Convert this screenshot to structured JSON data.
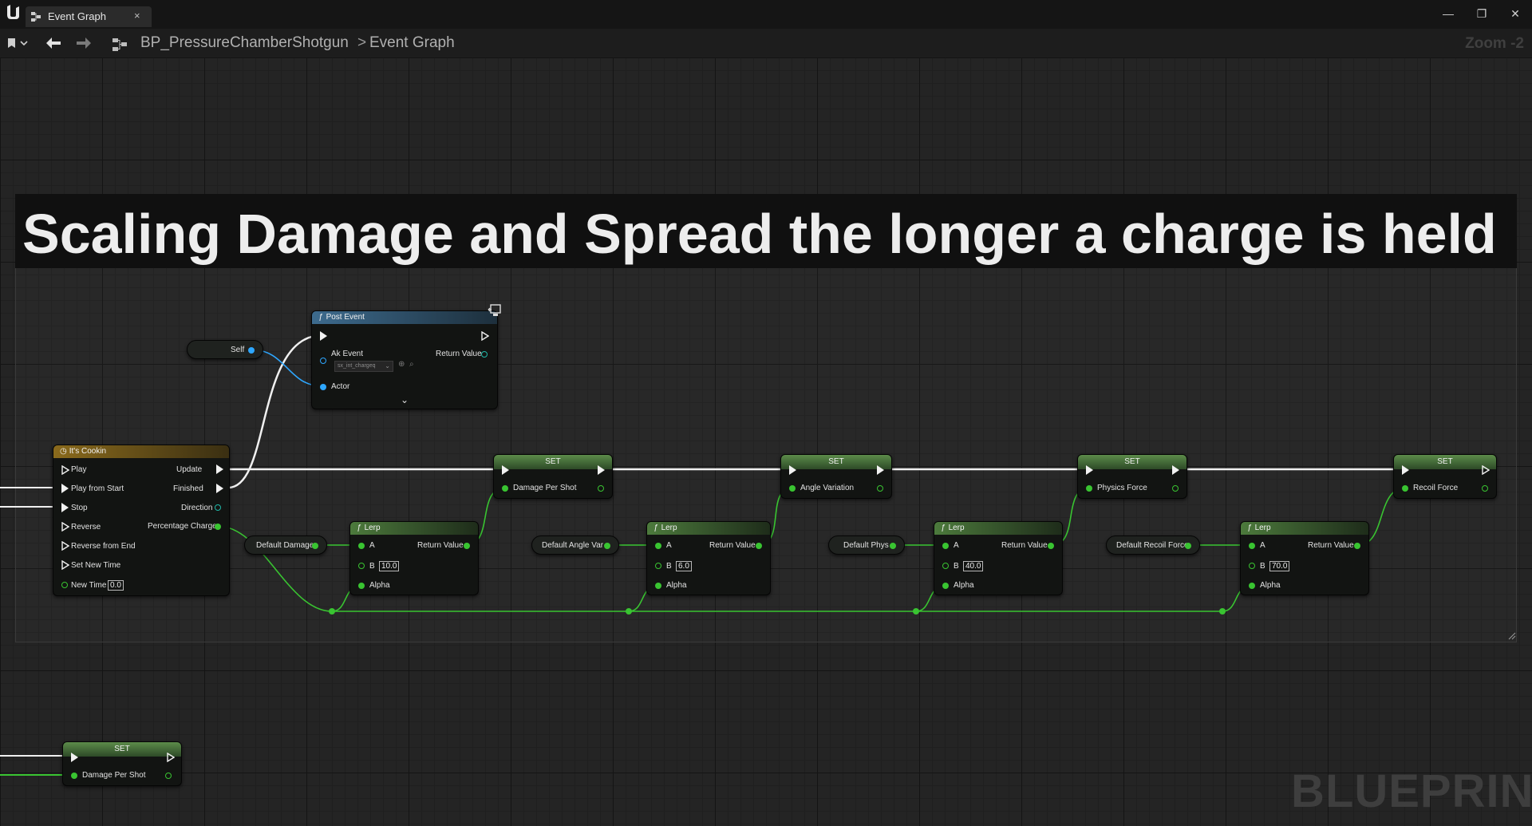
{
  "titlebar": {
    "tab_label": "Event Graph",
    "close_glyph": "×",
    "minimize_glyph": "—",
    "maximize_glyph": "❐",
    "window_close_glyph": "✕"
  },
  "toolbar": {
    "blueprint_name": "BP_PressureChamberShotgun",
    "separator": ">",
    "graph_name": "Event Graph",
    "zoom": "Zoom -2"
  },
  "comment": {
    "title": "Scaling Damage and Spread the longer a charge is held"
  },
  "watermark": "BLUEPRINT",
  "post_event": {
    "title": "Post Event",
    "ak_event_label": "Ak Event",
    "ak_event_value": "sx_int_chargeq",
    "return_value_label": "Return Value",
    "actor_label": "Actor",
    "self_label": "Self"
  },
  "timeline": {
    "title": "It's Cookin",
    "inputs": [
      "Play",
      "Play from Start",
      "Stop",
      "Reverse",
      "Reverse from End",
      "Set New Time"
    ],
    "new_time_label": "New Time",
    "new_time_value": "0.0",
    "outputs": {
      "update": "Update",
      "finished": "Finished",
      "direction": "Direction",
      "percentage": "Percentage Charge"
    }
  },
  "chains": [
    {
      "set_title": "SET",
      "set_var": "Damage Per Shot",
      "default_var": "Default Damage",
      "lerp_title": "Lerp",
      "a": "A",
      "b": "B",
      "b_value": "10.0",
      "alpha": "Alpha",
      "return_value": "Return Value"
    },
    {
      "set_title": "SET",
      "set_var": "Angle Variation",
      "default_var": "Default Angle Var",
      "lerp_title": "Lerp",
      "a": "A",
      "b": "B",
      "b_value": "6.0",
      "alpha": "Alpha",
      "return_value": "Return Value"
    },
    {
      "set_title": "SET",
      "set_var": "Physics Force",
      "default_var": "Default Phys",
      "lerp_title": "Lerp",
      "a": "A",
      "b": "B",
      "b_value": "40.0",
      "alpha": "Alpha",
      "return_value": "Return Value"
    },
    {
      "set_title": "SET",
      "set_var": "Recoil Force",
      "default_var": "Default Recoil Force",
      "lerp_title": "Lerp",
      "a": "A",
      "b": "B",
      "b_value": "70.0",
      "alpha": "Alpha",
      "return_value": "Return Value"
    }
  ],
  "bottom_set": {
    "title": "SET",
    "var": "Damage Per Shot"
  },
  "colors": {
    "exec_wire": "#f0f0f0",
    "float_wire": "#39c431",
    "object_wire": "#2ea7ff",
    "function_header": "#4c7a3c",
    "post_event_header": "#3d6b8e",
    "timeline_header": "#8a6a1c"
  }
}
